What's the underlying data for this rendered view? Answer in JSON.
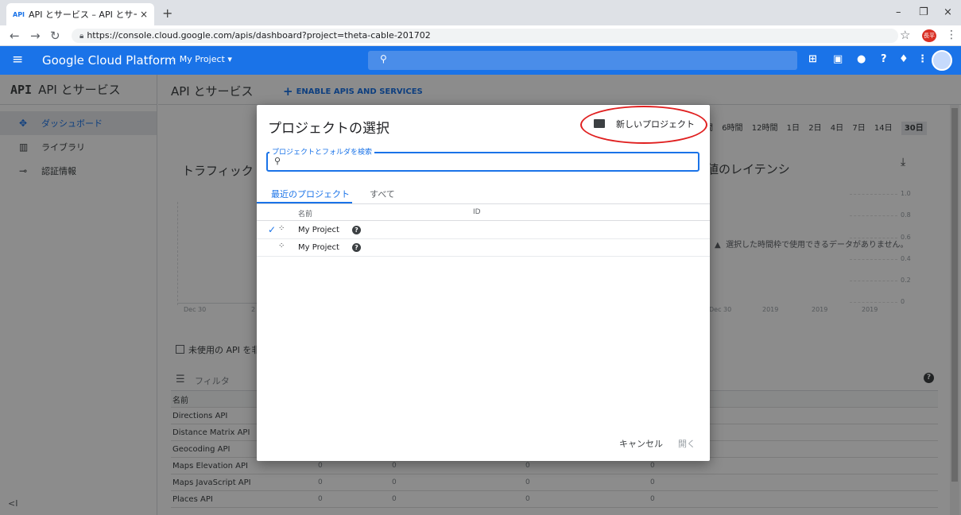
{
  "browser": {
    "tab_favicon": "API",
    "tab_title": "API とサービス – API とサービス – My",
    "tab_close": "×",
    "new_tab": "+",
    "window_controls": [
      "–",
      "❐",
      "×"
    ],
    "url": "https://console.cloud.google.com/apis/dashboard?project=theta-cable-201702",
    "profile_text": "長平"
  },
  "header": {
    "title": "Google Cloud Platform",
    "project": "My Project",
    "icons": [
      "gift-icon",
      "terminal-icon",
      "notifications-alert-icon",
      "help-icon",
      "bell-icon",
      "more-icon"
    ]
  },
  "sidebar": {
    "section_api": "API",
    "section_title": "API とサービス",
    "items": [
      {
        "label": "ダッシュボード",
        "icon": "dashboard-icon"
      },
      {
        "label": "ライブラリ",
        "icon": "library-icon"
      },
      {
        "label": "認証情報",
        "icon": "key-icon"
      }
    ]
  },
  "main": {
    "title": "API とサービス",
    "enable_label": "ENABLE APIS AND SERVICES",
    "time_ranges": [
      "間",
      "6時間",
      "12時間",
      "1日",
      "2日",
      "4日",
      "7日",
      "14日",
      "30日"
    ],
    "selected_range": "30日",
    "traffic_title": "トラフィック",
    "latency_title": "値のレイテンシ",
    "no_data": "選択した時間枠で使用できるデータがありません。",
    "y_ticks": [
      "1.0",
      "0.8",
      "0.6",
      "0.4",
      "0.2",
      "0"
    ],
    "x_ticks_left": [
      "Dec 30",
      "2"
    ],
    "x_ticks_right": [
      "Dec 30",
      "2019",
      "2019",
      "2019"
    ],
    "unused_label": "未使用の API を非表",
    "filter_label": "フィルタ",
    "table_header": "名前",
    "apis": [
      {
        "name": "Directions API"
      },
      {
        "name": "Distance Matrix API"
      },
      {
        "name": "Geocoding API"
      },
      {
        "name": "Maps Elevation API",
        "values": [
          "0",
          "0",
          "0",
          "0"
        ]
      },
      {
        "name": "Maps JavaScript API",
        "values": [
          "0",
          "0",
          "0",
          "0"
        ]
      },
      {
        "name": "Places API",
        "values": [
          "0",
          "0",
          "0",
          "0"
        ]
      }
    ]
  },
  "dialog": {
    "title": "プロジェクトの選択",
    "new_project": "新しいプロジェクト",
    "search_label": "プロジェクトとフォルダを検索",
    "search_value": "",
    "tab_recent": "最近のプロジェクト",
    "tab_all": "すべて",
    "col_name": "名前",
    "col_id": "ID",
    "projects": [
      {
        "name": "My Project",
        "selected": true
      },
      {
        "name": "My Project",
        "selected": false
      }
    ],
    "cancel": "キャンセル",
    "open": "開く"
  },
  "colors": {
    "brand": "#1a73e8",
    "annotation_ring": "#e02020"
  }
}
